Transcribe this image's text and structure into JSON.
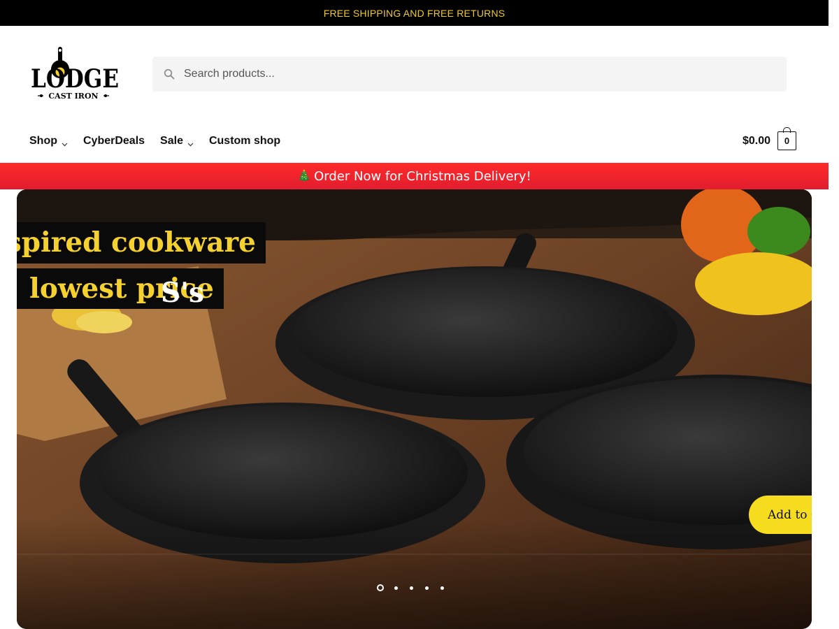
{
  "topbar": {
    "text": "FREE SHIPPING AND FREE RETURNS"
  },
  "logo": {
    "brand": "LODGE",
    "tagline": "CAST IRON"
  },
  "search": {
    "placeholder": "Search products..."
  },
  "nav": {
    "items": [
      {
        "label": "Shop",
        "has_dropdown": true
      },
      {
        "label": "CyberDeals",
        "has_dropdown": false
      },
      {
        "label": "Sale",
        "has_dropdown": true
      },
      {
        "label": "Custom shop",
        "has_dropdown": false
      }
    ]
  },
  "cart": {
    "amount": "$0.00",
    "count": "0"
  },
  "promo": {
    "icon": "christmas-tree-icon",
    "emoji": "🎄",
    "text": "Order Now for Christmas Delivery!"
  },
  "hero": {
    "headline_line1": "nspired cookware",
    "headline_line2_prefix": "S's ",
    "headline_line2_highlight": "lowest price",
    "cta_label": "Add to C",
    "slides_total": 5,
    "active_slide": 1
  },
  "colors": {
    "accent_yellow": "#f5d12f",
    "promo_red": "#ff2a2a",
    "topbar_text": "#f0c928"
  }
}
